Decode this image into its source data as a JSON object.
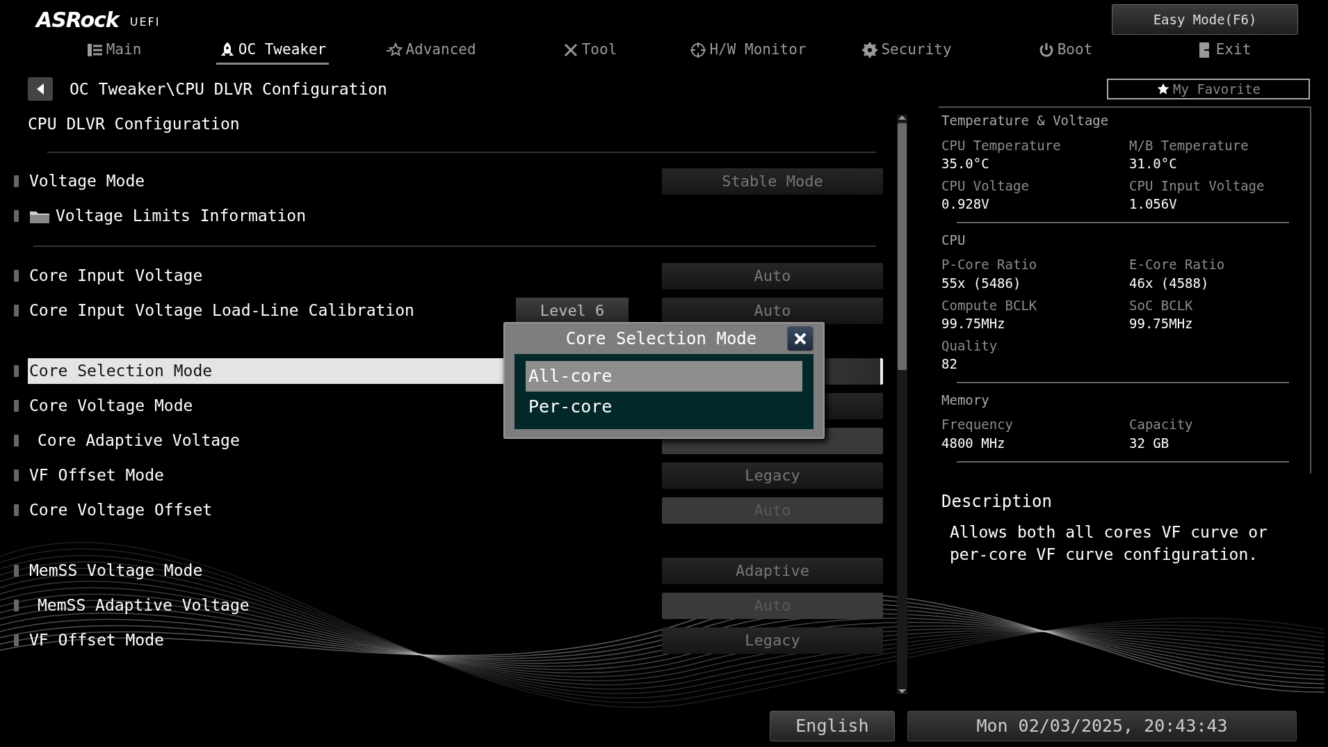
{
  "header": {
    "logo": "ASRock",
    "logo_suffix": "UEFI",
    "easy_mode_button": "Easy Mode(F6)"
  },
  "tabs": [
    {
      "label": "Main",
      "selected": false
    },
    {
      "label": "OC Tweaker",
      "selected": true
    },
    {
      "label": "Advanced",
      "selected": false
    },
    {
      "label": "Tool",
      "selected": false
    },
    {
      "label": "H/W Monitor",
      "selected": false
    },
    {
      "label": "Security",
      "selected": false
    },
    {
      "label": "Boot",
      "selected": false
    },
    {
      "label": "Exit",
      "selected": false
    }
  ],
  "breadcrumb": "OC Tweaker\\CPU DLVR Configuration",
  "favorite_button": "My Favorite",
  "page_title": "CPU DLVR Configuration",
  "sections": [
    {
      "divider_after": true,
      "rows": [
        {
          "kind": "setting",
          "label": "Voltage Mode",
          "value": "Stable Mode",
          "value_disabled": false,
          "selected": false
        },
        {
          "kind": "folder",
          "label": "Voltage Limits Information",
          "selected": false
        }
      ]
    },
    {
      "divider_after": false,
      "rows": [
        {
          "kind": "setting",
          "label": "Core Input Voltage",
          "value": "Auto",
          "value_disabled": false,
          "selected": false
        },
        {
          "kind": "setting",
          "label": "Core Input Voltage Load-Line Calibration",
          "extra": "Level 6",
          "value": "Auto",
          "value_disabled": false,
          "selected": false
        }
      ]
    },
    {
      "divider_after": false,
      "rows": [
        {
          "kind": "setting",
          "label": "Core Selection Mode",
          "value_disabled": false,
          "selected": true
        },
        {
          "kind": "setting",
          "label": "Core Voltage Mode",
          "value_disabled": false,
          "selected": false,
          "children": [
            {
              "kind": "setting",
              "label": "Core Adaptive Voltage",
              "value_disabled": true,
              "selected": false
            }
          ]
        },
        {
          "kind": "setting",
          "label": "VF Offset Mode",
          "value": "Legacy",
          "value_disabled": false,
          "selected": false
        },
        {
          "kind": "setting",
          "label": "Core Voltage Offset",
          "value": "Auto",
          "value_disabled": true,
          "selected": false
        }
      ]
    },
    {
      "divider_after": false,
      "rows": [
        {
          "kind": "setting",
          "label": "MemSS Voltage Mode",
          "value": "Adaptive",
          "value_disabled": false,
          "selected": false,
          "children": [
            {
              "kind": "setting",
              "label": "MemSS Adaptive Voltage",
              "value": "Auto",
              "value_disabled": true,
              "selected": false
            }
          ]
        },
        {
          "kind": "setting",
          "label": "VF Offset Mode",
          "value": "Legacy",
          "value_disabled": false,
          "selected": false
        }
      ]
    }
  ],
  "dialog": {
    "title": "Core Selection Mode",
    "options": [
      {
        "label": "All-core",
        "selected": true
      },
      {
        "label": "Per-core",
        "selected": false
      }
    ]
  },
  "monitor": [
    {
      "title": "Temperature & Voltage",
      "items": [
        {
          "label": "CPU Temperature",
          "value": "35.0°C"
        },
        {
          "label": "M/B Temperature",
          "value": "31.0°C"
        },
        {
          "label": "CPU Voltage",
          "value": "0.928V"
        },
        {
          "label": "CPU Input Voltage",
          "value": "1.056V"
        }
      ]
    },
    {
      "title": "CPU",
      "items": [
        {
          "label": "P-Core Ratio",
          "value": "55x (5486)"
        },
        {
          "label": "E-Core Ratio",
          "value": "46x (4588)"
        },
        {
          "label": "Compute BCLK",
          "value": "99.75MHz"
        },
        {
          "label": "SoC BCLK",
          "value": "99.75MHz"
        },
        {
          "label": "Quality",
          "value": "82"
        }
      ]
    },
    {
      "title": "Memory",
      "items": [
        {
          "label": "Frequency",
          "value": "4800 MHz"
        },
        {
          "label": "Capacity",
          "value": "32 GB"
        }
      ]
    }
  ],
  "description": {
    "title": "Description",
    "text": "Allows both all cores VF curve or per-core VF curve configuration."
  },
  "footer": {
    "language": "English",
    "datetime": "Mon 02/03/2025, 20:43:43"
  }
}
